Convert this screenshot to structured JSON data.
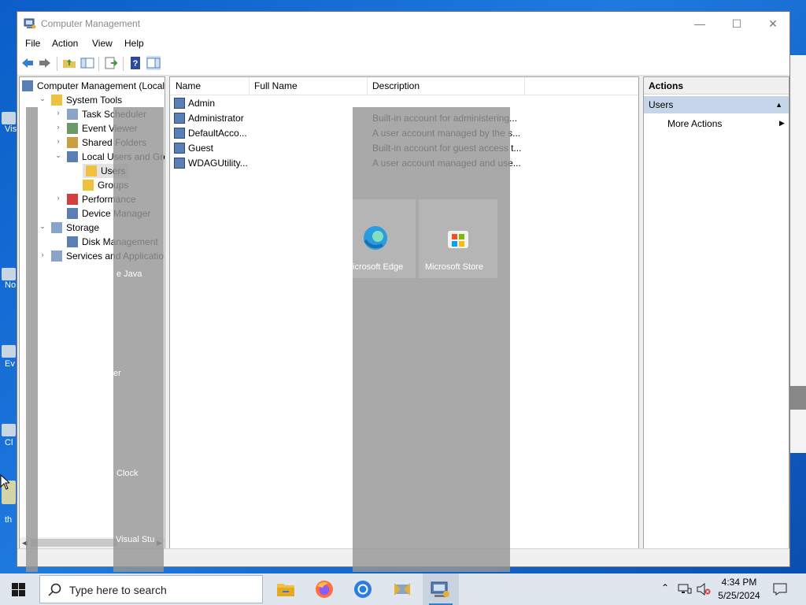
{
  "desktop": {
    "icons": [
      {
        "label": "Vis"
      },
      {
        "label": "No"
      },
      {
        "label": "Ev"
      },
      {
        "label": "Cl"
      },
      {
        "label": "th"
      }
    ],
    "tiles": [
      {
        "label": "icrosoft Edge",
        "icon": "edge-icon"
      },
      {
        "label": "Microsoft Store",
        "icon": "store-icon"
      }
    ],
    "ghost_labels": [
      "e Java",
      "er",
      "Clock",
      "Visual Stu"
    ]
  },
  "window": {
    "title": "Computer Management",
    "controls": {
      "minimize": "—",
      "maximize": "☐",
      "close": "✕"
    },
    "menu": [
      "File",
      "Action",
      "View",
      "Help"
    ],
    "toolbar_icons": [
      "back-icon",
      "forward-icon",
      "up-folder-icon",
      "show-hide-console-tree-icon",
      "export-list-icon",
      "help-icon",
      "show-hide-action-pane-icon"
    ]
  },
  "tree": {
    "root": "Computer Management (Local",
    "items": [
      {
        "label": "System Tools",
        "level": 1,
        "expander": "⌄"
      },
      {
        "label": "Task Scheduler",
        "level": 2,
        "expander": "›"
      },
      {
        "label": "Event Viewer",
        "level": 2,
        "expander": "›"
      },
      {
        "label": "Shared Folders",
        "level": 2,
        "expander": "›"
      },
      {
        "label": "Local Users and Groups",
        "level": 2,
        "expander": "⌄"
      },
      {
        "label": "Users",
        "level": 3,
        "expander": "",
        "selected": true
      },
      {
        "label": "Groups",
        "level": 3,
        "expander": ""
      },
      {
        "label": "Performance",
        "level": 2,
        "expander": "›"
      },
      {
        "label": "Device Manager",
        "level": 2,
        "expander": ""
      },
      {
        "label": "Storage",
        "level": 1,
        "expander": "⌄"
      },
      {
        "label": "Disk Management",
        "level": 2,
        "expander": ""
      },
      {
        "label": "Services and Applications",
        "level": 1,
        "expander": "›"
      }
    ]
  },
  "list": {
    "columns": [
      "Name",
      "Full Name",
      "Description"
    ],
    "rows": [
      {
        "name": "Admin",
        "full_name": "",
        "description": ""
      },
      {
        "name": "Administrator",
        "full_name": "",
        "description": "Built-in account for administering..."
      },
      {
        "name": "DefaultAcco...",
        "full_name": "",
        "description": "A user account managed by the s..."
      },
      {
        "name": "Guest",
        "full_name": "",
        "description": "Built-in account for guest access t..."
      },
      {
        "name": "WDAGUtility...",
        "full_name": "",
        "description": "A user account managed and use..."
      }
    ]
  },
  "actions": {
    "header": "Actions",
    "section": "Users",
    "section_arrow": "▲",
    "item": "More Actions",
    "item_arrow": "▶"
  },
  "taskbar": {
    "search_placeholder": "Type here to search",
    "apps": [
      "file-explorer-icon",
      "firefox-icon",
      "chrome-icon",
      "network-app-icon",
      "computer-management-icon"
    ],
    "time": "4:34 PM",
    "date": "5/25/2024"
  },
  "colors": {
    "desktop": "#1f7ae0",
    "selection": "#c6d5ea",
    "taskbar": "#dfe6ee"
  }
}
